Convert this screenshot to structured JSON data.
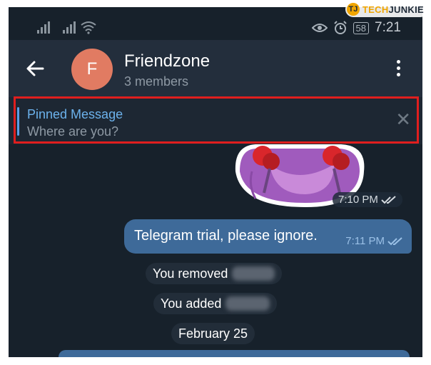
{
  "watermark": {
    "logo": "TJ",
    "tech": "TECH",
    "junkie": "JUNKIE"
  },
  "status_bar": {
    "battery": "58",
    "time": "7:21",
    "icons": [
      "signal-icon",
      "signal-icon",
      "wifi-icon",
      "eye-icon",
      "alarm-icon",
      "battery-icon"
    ]
  },
  "header": {
    "avatar_letter": "F",
    "title": "Friendzone",
    "subtitle": "3 members",
    "back_icon": "back-arrow-icon",
    "menu_icon": "more-vertical-icon"
  },
  "pinned": {
    "title": "Pinned Message",
    "text": "Where are you?",
    "close_icon": "close-icon"
  },
  "messages": {
    "sticker_time": "7:10 PM",
    "outgoing_text": "Telegram trial, please ignore.",
    "outgoing_time": "7:11 PM"
  },
  "service": {
    "removed": "You removed",
    "added": "You added",
    "date": "February 25"
  },
  "colors": {
    "background": "#17212b",
    "header": "#232e3c",
    "accent": "#6cb2ec",
    "bubble": "#3e6a99",
    "avatar": "#e17b62",
    "highlight": "#e01e1e"
  }
}
